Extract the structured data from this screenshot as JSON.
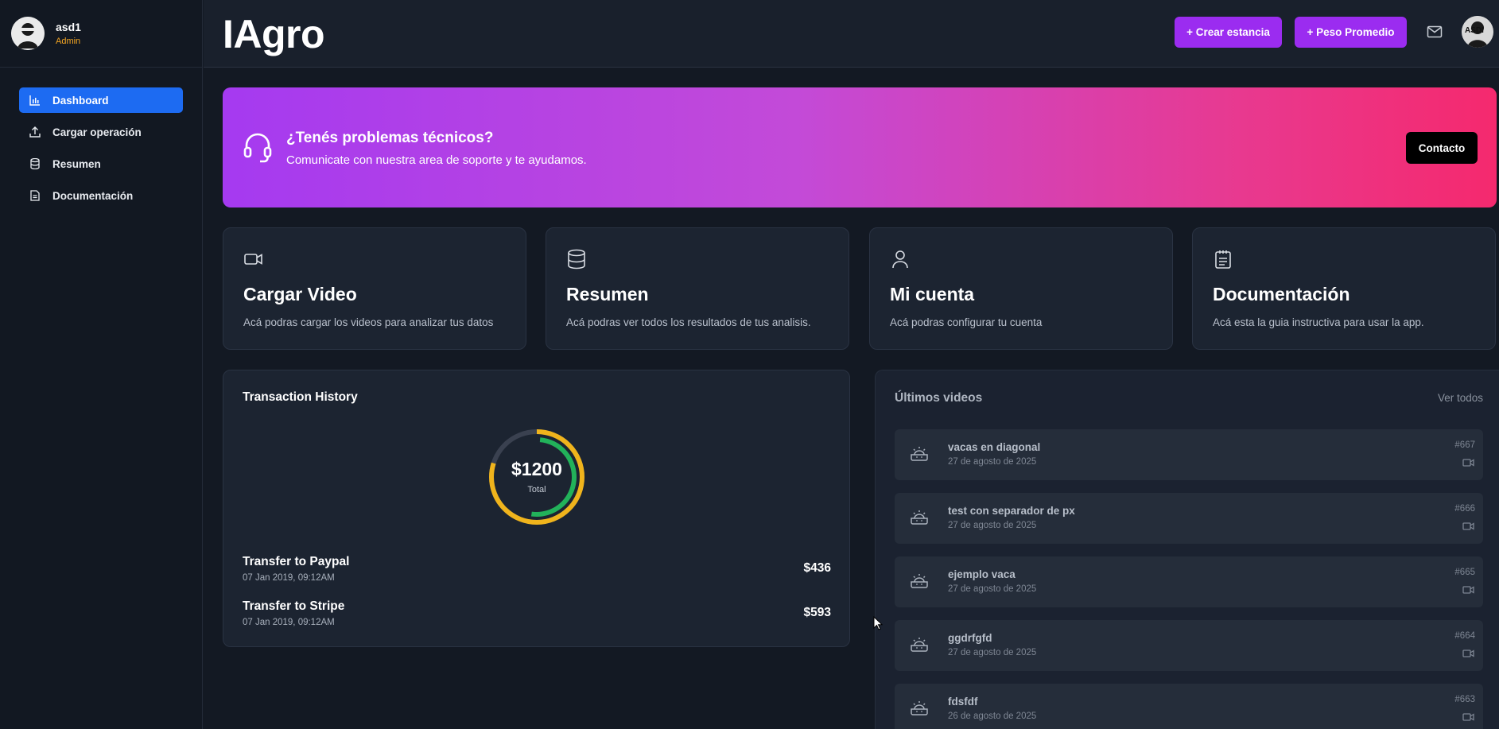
{
  "sidebar": {
    "user": {
      "name": "asd1",
      "role": "Admin"
    },
    "items": [
      {
        "label": "Dashboard",
        "icon": "bar-chart-icon",
        "active": true
      },
      {
        "label": "Cargar operación",
        "icon": "upload-icon",
        "active": false
      },
      {
        "label": "Resumen",
        "icon": "database-icon",
        "active": false
      },
      {
        "label": "Documentación",
        "icon": "document-icon",
        "active": false
      }
    ]
  },
  "header": {
    "title": "IAgro",
    "create_label": "+ Crear estancia",
    "weight_label": "+ Peso Promedio",
    "avatar_text": "ASDI"
  },
  "banner": {
    "title": "¿Tenés problemas técnicos?",
    "subtitle": "Comunicate con nuestra area de soporte y te ayudamos.",
    "button": "Contacto"
  },
  "cards": [
    {
      "icon": "video-camera-icon",
      "title": "Cargar Video",
      "desc": "Acá podras cargar los videos para analizar tus datos"
    },
    {
      "icon": "database-icon",
      "title": "Resumen",
      "desc": "Acá podras ver todos los resultados de tus analisis."
    },
    {
      "icon": "user-icon",
      "title": "Mi cuenta",
      "desc": "Acá podras configurar tu cuenta"
    },
    {
      "icon": "clipboard-icon",
      "title": "Documentación",
      "desc": "Acá esta la guia instructiva para usar la app."
    }
  ],
  "transactions": {
    "title": "Transaction History",
    "total": "$1200",
    "total_label": "Total",
    "items": [
      {
        "name": "Transfer to Paypal",
        "date": "07 Jan 2019, 09:12AM",
        "amount": "$436"
      },
      {
        "name": "Transfer to Stripe",
        "date": "07 Jan 2019, 09:12AM",
        "amount": "$593"
      }
    ]
  },
  "videos": {
    "title": "Últimos videos",
    "view_all": "Ver todos",
    "items": [
      {
        "name": "vacas en diagonal",
        "date": "27 de agosto de 2025",
        "id": "#667"
      },
      {
        "name": "test con separador de px",
        "date": "27 de agosto de 2025",
        "id": "#666"
      },
      {
        "name": "ejemplo vaca",
        "date": "27 de agosto de 2025",
        "id": "#665"
      },
      {
        "name": "ggdrfgfd",
        "date": "27 de agosto de 2025",
        "id": "#664"
      },
      {
        "name": "fdsfdf",
        "date": "26 de agosto de 2025",
        "id": "#663"
      }
    ]
  },
  "colors": {
    "accent_blue": "#1d6bf2",
    "button_purple": "#9b2cf0",
    "donut_outer": "#f0b41c",
    "donut_inner": "#22b25a",
    "role_orange": "#f5a623"
  }
}
